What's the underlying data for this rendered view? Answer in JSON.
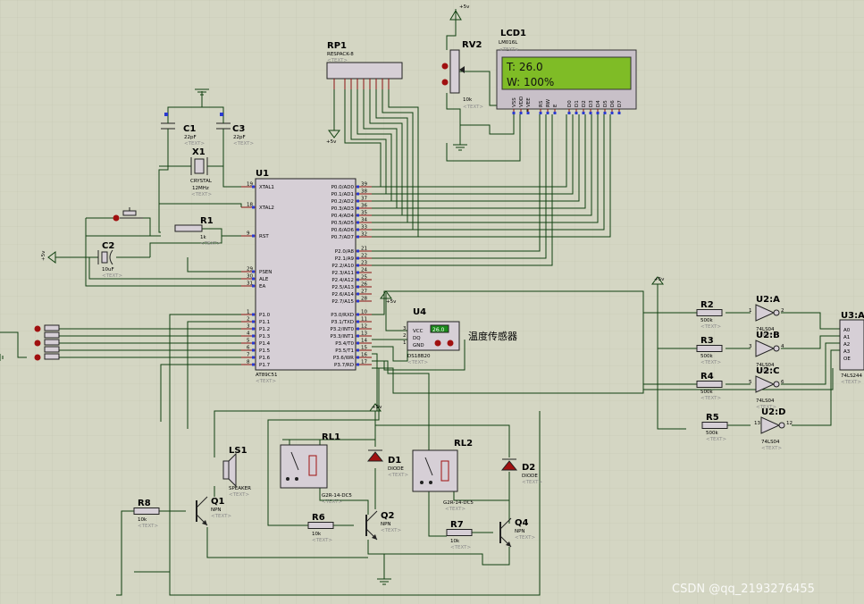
{
  "watermark": "CSDN @qq_2193276455",
  "lcd": {
    "ref": "LCD1",
    "part": "LM016L",
    "line1": "T:  26.0",
    "line2": "W:  100%",
    "text": "<TEXT>",
    "pins": [
      "VSS",
      "VDD",
      "VEE",
      "RS",
      "RW",
      "E",
      "D0",
      "D1",
      "D2",
      "D3",
      "D4",
      "D5",
      "D6",
      "D7"
    ]
  },
  "power": {
    "vcc": "+5v"
  },
  "rv2": {
    "ref": "RV2",
    "value": "10k",
    "text": "<TEXT>"
  },
  "rp1": {
    "ref": "RP1",
    "part": "RESPACK-8",
    "text": "<TEXT>"
  },
  "c1": {
    "ref": "C1",
    "value": "22pF",
    "text": "<TEXT>"
  },
  "c3": {
    "ref": "C3",
    "value": "22pF",
    "text": "<TEXT>"
  },
  "x1": {
    "ref": "X1",
    "part": "CRYSTAL",
    "value": "12MHz",
    "text": "<TEXT>"
  },
  "r1": {
    "ref": "R1",
    "value": "1k",
    "text": "<TEXT>"
  },
  "c2": {
    "ref": "C2",
    "value": "10uF",
    "text": "<TEXT>"
  },
  "u1": {
    "ref": "U1",
    "part": "AT89C51",
    "text": "<TEXT>",
    "left_pins": [
      {
        "num": "19",
        "name": "XTAL1"
      },
      {
        "num": "18",
        "name": "XTAL2"
      },
      {
        "num": "9",
        "name": "RST"
      },
      {
        "num": "29",
        "name": "PSEN"
      },
      {
        "num": "30",
        "name": "ALE"
      },
      {
        "num": "31",
        "name": "EA"
      },
      {
        "num": "1",
        "name": "P1.0"
      },
      {
        "num": "2",
        "name": "P1.1"
      },
      {
        "num": "3",
        "name": "P1.2"
      },
      {
        "num": "4",
        "name": "P1.3"
      },
      {
        "num": "5",
        "name": "P1.4"
      },
      {
        "num": "6",
        "name": "P1.5"
      },
      {
        "num": "7",
        "name": "P1.6"
      },
      {
        "num": "8",
        "name": "P1.7"
      }
    ],
    "right_pins": [
      {
        "num": "39",
        "name": "P0.0/AD0"
      },
      {
        "num": "38",
        "name": "P0.1/AD1"
      },
      {
        "num": "37",
        "name": "P0.2/AD2"
      },
      {
        "num": "36",
        "name": "P0.3/AD3"
      },
      {
        "num": "35",
        "name": "P0.4/AD4"
      },
      {
        "num": "34",
        "name": "P0.5/AD5"
      },
      {
        "num": "33",
        "name": "P0.6/AD6"
      },
      {
        "num": "32",
        "name": "P0.7/AD7"
      },
      {
        "num": "21",
        "name": "P2.0/A8"
      },
      {
        "num": "22",
        "name": "P2.1/A9"
      },
      {
        "num": "23",
        "name": "P2.2/A10"
      },
      {
        "num": "24",
        "name": "P2.3/A11"
      },
      {
        "num": "25",
        "name": "P2.4/A12"
      },
      {
        "num": "26",
        "name": "P2.5/A13"
      },
      {
        "num": "27",
        "name": "P2.6/A14"
      },
      {
        "num": "28",
        "name": "P2.7/A15"
      },
      {
        "num": "10",
        "name": "P3.0/RXD"
      },
      {
        "num": "11",
        "name": "P3.1/TXD"
      },
      {
        "num": "12",
        "name": "P3.2/INT0"
      },
      {
        "num": "13",
        "name": "P3.3/INT1"
      },
      {
        "num": "14",
        "name": "P3.4/T0"
      },
      {
        "num": "15",
        "name": "P3.5/T1"
      },
      {
        "num": "16",
        "name": "P3.6/WR"
      },
      {
        "num": "17",
        "name": "P3.7/RD"
      }
    ]
  },
  "u4": {
    "ref": "U4",
    "part": "DS18B20",
    "label": "温度传感器",
    "reading": "26.0",
    "text": "<TEXT>",
    "pins": [
      {
        "num": "3",
        "name": "VCC"
      },
      {
        "num": "2",
        "name": "DQ"
      },
      {
        "num": "1",
        "name": "GND"
      }
    ]
  },
  "r2": {
    "ref": "R2",
    "value": "500k",
    "text": "<TEXT>"
  },
  "r3": {
    "ref": "R3",
    "value": "500k",
    "text": "<TEXT>"
  },
  "r4": {
    "ref": "R4",
    "value": "500k",
    "text": "<TEXT>"
  },
  "r5": {
    "ref": "R5",
    "value": "500k",
    "text": "<TEXT>"
  },
  "u2a": {
    "ref": "U2:A",
    "part": "74LS04",
    "in": "1",
    "out": "2",
    "text": "<TEXT>"
  },
  "u2b": {
    "ref": "U2:B",
    "part": "74LS04",
    "in": "3",
    "out": "4",
    "text": "<TEXT>"
  },
  "u2c": {
    "ref": "U2:C",
    "part": "74LS04",
    "in": "5",
    "out": "6",
    "text": "<TEXT>"
  },
  "u2d": {
    "ref": "U2:D",
    "part": "74LS04",
    "in": "13",
    "out": "12",
    "text": "<TEXT>"
  },
  "u3a": {
    "ref": "U3:A",
    "part": "74LS244",
    "pins": [
      "A0",
      "A1",
      "A2",
      "A3",
      "OE"
    ],
    "text": "<TEXT>"
  },
  "ls1": {
    "ref": "LS1",
    "part": "SPEAKER",
    "text": "<TEXT>"
  },
  "rl1": {
    "ref": "RL1",
    "part": "G2R-14-DC5",
    "text": "<TEXT>"
  },
  "rl2": {
    "ref": "RL2",
    "part": "G2R-14-DC5",
    "text": "<TEXT>"
  },
  "d1": {
    "ref": "D1",
    "part": "DIODE",
    "text": "<TEXT>"
  },
  "d2": {
    "ref": "D2",
    "part": "DIODE",
    "text": "<TEXT>"
  },
  "q1": {
    "ref": "Q1",
    "part": "NPN",
    "text": "<TEXT>"
  },
  "q2": {
    "ref": "Q2",
    "part": "NPN",
    "text": "<TEXT>"
  },
  "q4": {
    "ref": "Q4",
    "part": "NPN",
    "text": "<TEXT>"
  },
  "r6": {
    "ref": "R6",
    "value": "10k",
    "text": "<TEXT>"
  },
  "r7": {
    "ref": "R7",
    "value": "10k",
    "text": "<TEXT>"
  },
  "r8": {
    "ref": "R8",
    "value": "10k",
    "text": "<TEXT>"
  }
}
